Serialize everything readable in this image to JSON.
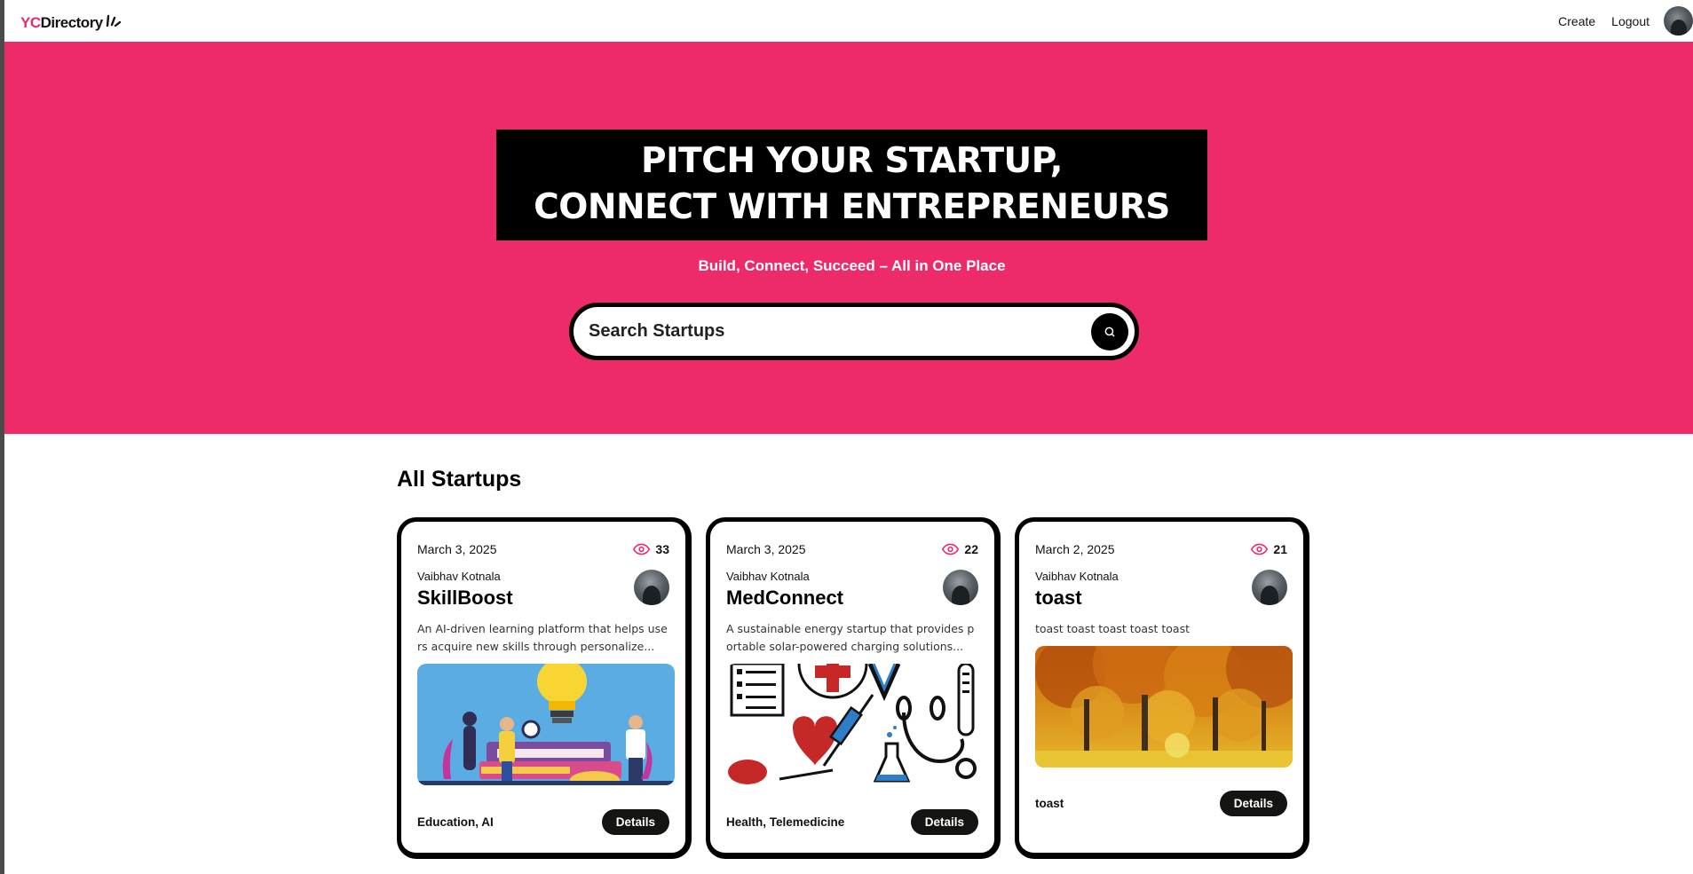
{
  "navbar": {
    "logo_yc": "YC",
    "logo_directory": "Directory",
    "create_label": "Create",
    "logout_label": "Logout"
  },
  "hero": {
    "heading_line1": "Pitch Your Startup,",
    "heading_line2": "Connect With Entrepreneurs",
    "subheading": "Build, Connect, Succeed – All in One Place",
    "search_placeholder": "Search Startups"
  },
  "section": {
    "title": "All Startups"
  },
  "startups": [
    {
      "date": "March 3, 2025",
      "views": "33",
      "author": "Vaibhav Kotnala",
      "title": "SkillBoost",
      "description": "An AI-driven learning platform that helps users acquire new skills through personalize...",
      "category": "Education, AI",
      "details_label": "Details",
      "image_icon": "learning-illustration"
    },
    {
      "date": "March 3, 2025",
      "views": "22",
      "author": "Vaibhav Kotnala",
      "title": "MedConnect",
      "description": "A sustainable energy startup that provides portable solar-powered charging solutions...",
      "category": "Health, Telemedicine",
      "details_label": "Details",
      "image_icon": "medical-illustration"
    },
    {
      "date": "March 2, 2025",
      "views": "21",
      "author": "Vaibhav Kotnala",
      "title": "toast",
      "description": "toast toast toast toast toast",
      "category": "toast",
      "details_label": "Details",
      "image_icon": "autumn-trees-photo"
    }
  ],
  "colors": {
    "brand_pink": "#EE2B69",
    "black": "#000000",
    "button_dark": "#141413"
  }
}
